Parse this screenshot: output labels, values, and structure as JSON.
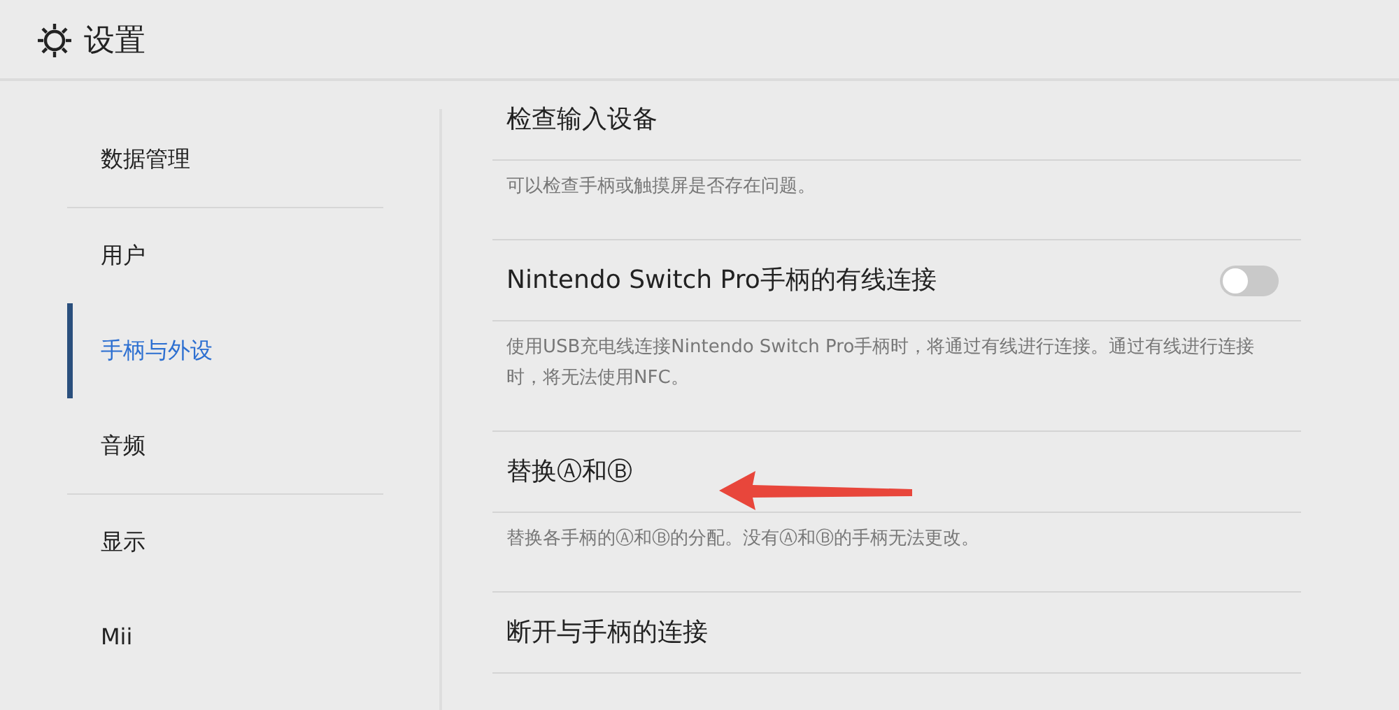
{
  "header": {
    "title": "设置"
  },
  "sidebar": {
    "items": [
      {
        "label": "数据管理",
        "selected": false,
        "divider_after": true
      },
      {
        "label": "用户",
        "selected": false,
        "divider_after": false
      },
      {
        "label": "手柄与外设",
        "selected": true,
        "divider_after": false
      },
      {
        "label": "音频",
        "selected": false,
        "divider_after": true
      },
      {
        "label": "显示",
        "selected": false,
        "divider_after": false
      },
      {
        "label": "Mii",
        "selected": false,
        "divider_after": false
      }
    ]
  },
  "content": {
    "rows": [
      {
        "kind": "option",
        "title": "检查输入设备"
      },
      {
        "kind": "description",
        "text": "可以检查手柄或触摸屏是否存在问题。"
      },
      {
        "kind": "option",
        "title": "Nintendo Switch Pro手柄的有线连接",
        "toggle": {
          "on": false
        }
      },
      {
        "kind": "description",
        "text": "使用USB充电线连接Nintendo Switch Pro手柄时，将通过有线进行连接。通过有线进行连接时，将无法使用NFC。"
      },
      {
        "kind": "option",
        "title": "替换Ⓐ和Ⓑ"
      },
      {
        "kind": "description",
        "text": "替换各手柄的Ⓐ和Ⓑ的分配。没有Ⓐ和Ⓑ的手柄无法更改。"
      },
      {
        "kind": "option",
        "title": "断开与手柄的连接"
      }
    ]
  }
}
